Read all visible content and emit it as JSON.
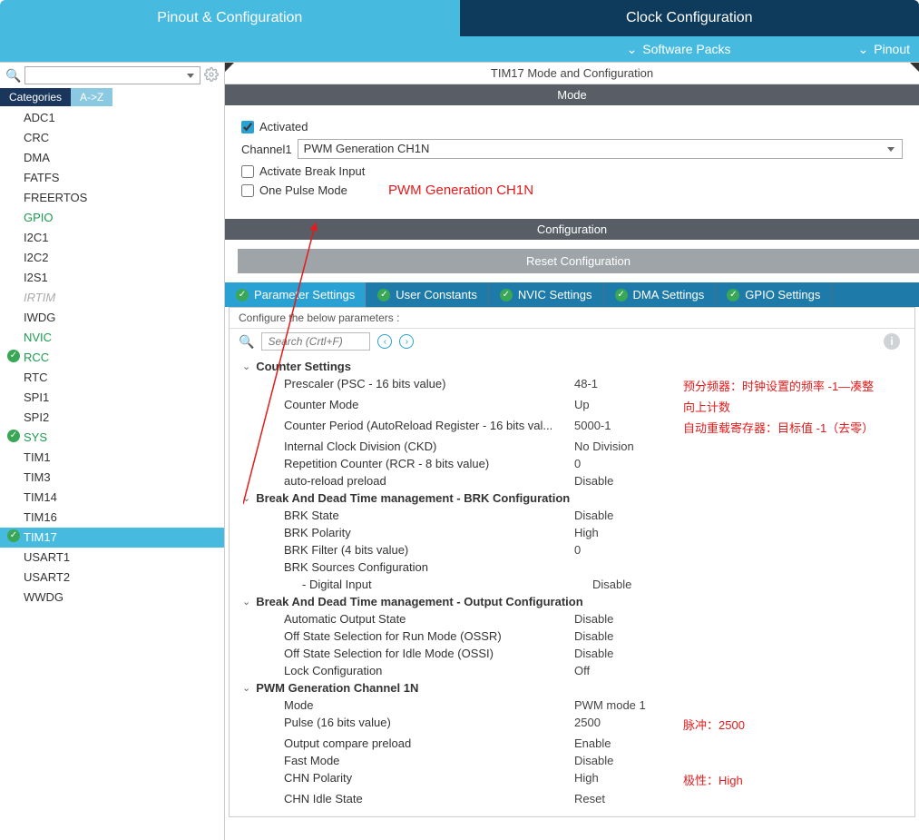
{
  "topTabs": {
    "active": "Pinout & Configuration",
    "inactive": "Clock Configuration"
  },
  "subBar": {
    "packs": "Software Packs",
    "pinout": "Pinout"
  },
  "sideTabs": {
    "categories": "Categories",
    "az": "A->Z"
  },
  "sidebar": {
    "items": [
      {
        "label": "ADC1"
      },
      {
        "label": "CRC"
      },
      {
        "label": "DMA"
      },
      {
        "label": "FATFS"
      },
      {
        "label": "FREERTOS"
      },
      {
        "label": "GPIO",
        "cls": "green"
      },
      {
        "label": "I2C1"
      },
      {
        "label": "I2C2"
      },
      {
        "label": "I2S1"
      },
      {
        "label": "IRTIM",
        "cls": "gray"
      },
      {
        "label": "IWDG"
      },
      {
        "label": "NVIC",
        "cls": "green"
      },
      {
        "label": "RCC",
        "cls": "green",
        "badge": "check"
      },
      {
        "label": "RTC"
      },
      {
        "label": "SPI1"
      },
      {
        "label": "SPI2"
      },
      {
        "label": "SYS",
        "cls": "green",
        "badge": "check"
      },
      {
        "label": "TIM1"
      },
      {
        "label": "TIM3"
      },
      {
        "label": "TIM14"
      },
      {
        "label": "TIM16"
      },
      {
        "label": "TIM17",
        "badge": "check",
        "selected": true
      },
      {
        "label": "USART1"
      },
      {
        "label": "USART2"
      },
      {
        "label": "WWDG"
      }
    ]
  },
  "peripheralTitle": "TIM17 Mode and Configuration",
  "sections": {
    "mode": "Mode",
    "config": "Configuration"
  },
  "mode": {
    "activated": "Activated",
    "channelLabel": "Channel1",
    "channelValue": "PWM Generation CH1N",
    "breakInput": "Activate Break Input",
    "onePulse": "One Pulse Mode"
  },
  "resetBtn": "Reset Configuration",
  "cfgTabs": {
    "t0": "Parameter Settings",
    "t1": "User Constants",
    "t2": "NVIC Settings",
    "t3": "DMA Settings",
    "t4": "GPIO Settings"
  },
  "paramsHeader": "Configure the below parameters :",
  "searchPlaceholder": "Search (Crtl+F)",
  "groups": {
    "g0": {
      "title": "Counter Settings",
      "rows": [
        {
          "name": "Prescaler (PSC - 16 bits value)",
          "val": "48-1",
          "annot": "预分频器：时钟设置的频率 -1—凑整"
        },
        {
          "name": "Counter Mode",
          "val": "Up",
          "annot": "向上计数"
        },
        {
          "name": "Counter Period (AutoReload Register - 16 bits val...",
          "val": "5000-1",
          "annot": "自动重载寄存器：目标值 -1（去零）"
        },
        {
          "name": "Internal Clock Division (CKD)",
          "val": "No Division"
        },
        {
          "name": "Repetition Counter (RCR - 8 bits value)",
          "val": "0"
        },
        {
          "name": "auto-reload preload",
          "val": "Disable"
        }
      ]
    },
    "g1": {
      "title": "Break And Dead Time management - BRK Configuration",
      "rows": [
        {
          "name": "BRK State",
          "val": "Disable"
        },
        {
          "name": "BRK Polarity",
          "val": "High"
        },
        {
          "name": "BRK Filter (4 bits value)",
          "val": "0"
        },
        {
          "name": "BRK Sources Configuration",
          "val": ""
        },
        {
          "name": "- Digital Input",
          "val": "Disable",
          "sub": true
        }
      ]
    },
    "g2": {
      "title": "Break And Dead Time management - Output Configuration",
      "rows": [
        {
          "name": "Automatic Output State",
          "val": "Disable"
        },
        {
          "name": "Off State Selection for Run Mode (OSSR)",
          "val": "Disable"
        },
        {
          "name": "Off State Selection for Idle Mode (OSSI)",
          "val": "Disable"
        },
        {
          "name": "Lock Configuration",
          "val": "Off"
        }
      ]
    },
    "g3": {
      "title": "PWM Generation Channel 1N",
      "rows": [
        {
          "name": "Mode",
          "val": "PWM mode 1"
        },
        {
          "name": "Pulse (16 bits value)",
          "val": "2500",
          "annot": "脉冲：2500"
        },
        {
          "name": "Output compare preload",
          "val": "Enable"
        },
        {
          "name": "Fast Mode",
          "val": "Disable"
        },
        {
          "name": "CHN Polarity",
          "val": "High",
          "annot": "极性：High"
        },
        {
          "name": "CHN Idle State",
          "val": "Reset"
        }
      ]
    }
  },
  "floatAnnot": "PWM Generation CH1N"
}
